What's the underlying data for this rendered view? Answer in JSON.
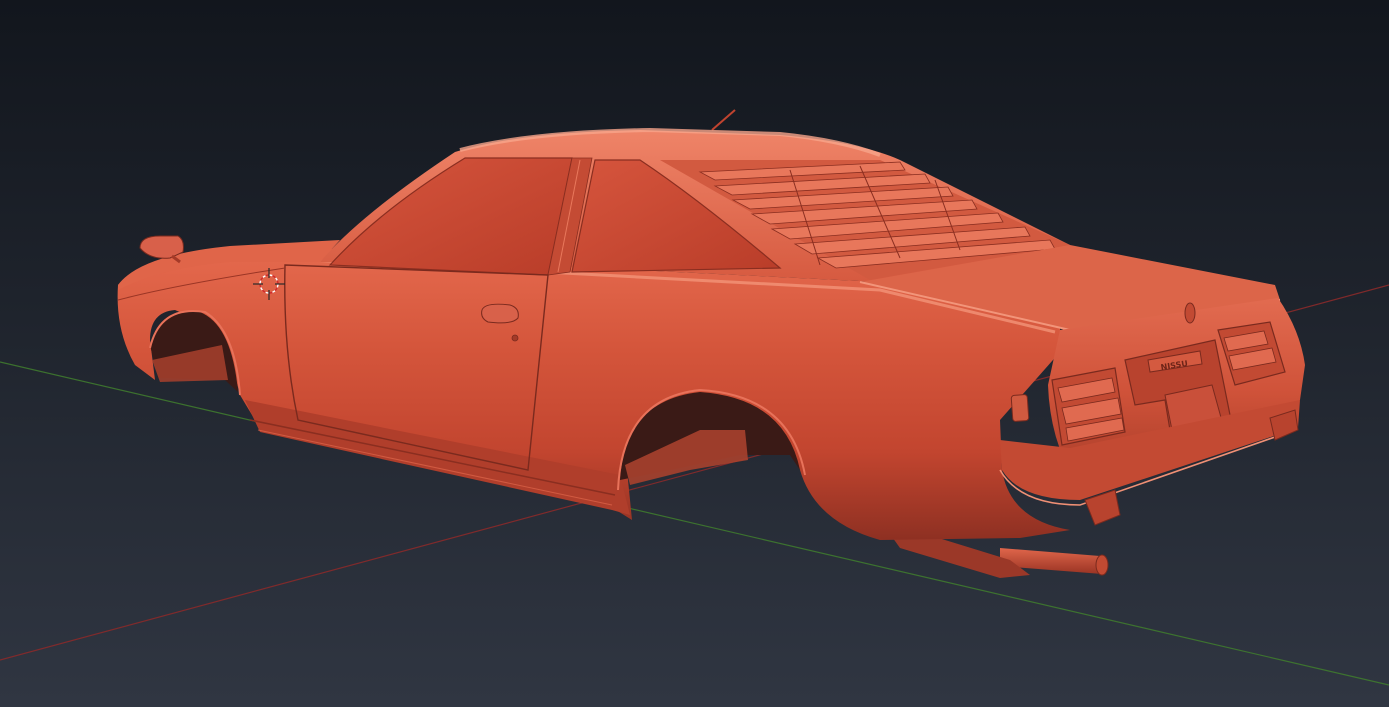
{
  "viewport": {
    "background_top": "#13171e",
    "background_bottom": "#2e3440",
    "axis_x_color": "#8a2a2a",
    "axis_y_color": "#3f7a2e"
  },
  "model": {
    "body_color": "#c8432e",
    "highlight_color": "#ea7558",
    "shadow_color": "#7a2a1e",
    "plate_text": "NISSU"
  },
  "icons": {
    "cursor": "3d-cursor-icon"
  }
}
